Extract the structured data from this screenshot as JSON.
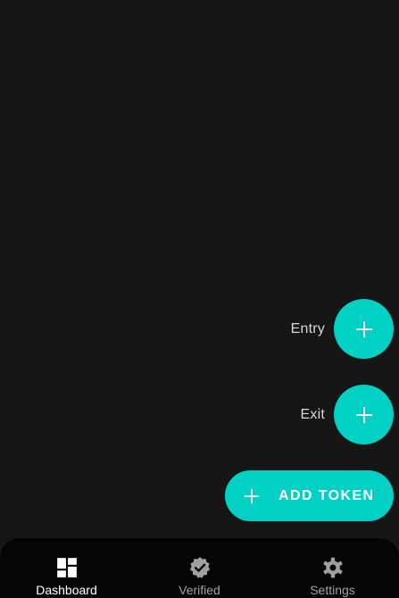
{
  "fab_menu": {
    "entry": {
      "label": "Entry",
      "icon": "plus-icon"
    },
    "exit": {
      "label": "Exit",
      "icon": "plus-icon"
    },
    "add_token": {
      "label": "ADD TOKEN",
      "icon": "plus-icon"
    }
  },
  "bottom_nav": {
    "items": [
      {
        "label": "Dashboard",
        "icon": "dashboard-icon",
        "active": true
      },
      {
        "label": "Verified",
        "icon": "verified-badge-icon",
        "active": false
      },
      {
        "label": "Settings",
        "icon": "gear-icon",
        "active": false
      }
    ]
  },
  "colors": {
    "background": "#161616",
    "accent": "#00d1c4",
    "nav_background": "#050505",
    "nav_active": "#ffffff",
    "nav_inactive": "#a0a0a0"
  }
}
